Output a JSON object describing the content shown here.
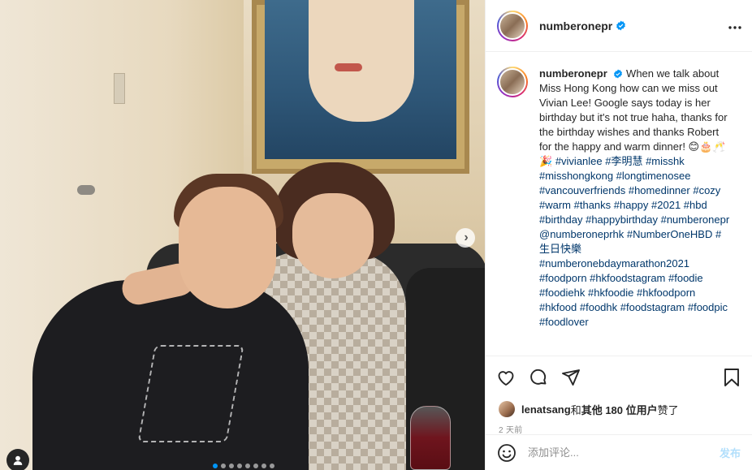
{
  "post": {
    "username": "numberonepr",
    "caption_text": "When we talk about Miss Hong Kong how can we miss out Vivian Lee! Google says today is her birthday but it's not true haha, thanks for the birthday wishes and thanks Robert for the happy and warm dinner! 😊🎂🥂🎉 ",
    "caption_tags": "#vivianlee #李明慧 #misshk #misshongkong #longtimenosee #vancouverfriends #homedinner #cozy #warm #thanks #happy #2021 #hbd #birthday #happybirthday #numberonepr @numberoneprhk #NumberOneHBD #生日快樂 #numberonebdaymarathon2021 #foodporn #hkfoodstagram #foodie #foodiehk #hkfoodie #hkfoodporn #hkfood #foodhk #foodstagram #foodpic #foodlover",
    "more_icon": "more-horizontal-icon",
    "verified_icon": "verified-badge-icon"
  },
  "media": {
    "next_icon": "chevron-right-icon",
    "next_glyph": "›",
    "tag_icon": "user-tag-icon",
    "slide_count": 8,
    "active_slide": 1
  },
  "actions": {
    "like_icon": "heart-icon",
    "comment_icon": "comment-icon",
    "share_icon": "send-icon",
    "save_icon": "bookmark-icon"
  },
  "likes": {
    "liker": "lenatsang",
    "connector": " 和 ",
    "others": "其他 180 位用户",
    "suffix": " 赞了"
  },
  "timestamp": "2 天前",
  "comment_box": {
    "emoji_icon": "emoji-icon",
    "placeholder": "添加评论...",
    "post_label": "发布"
  },
  "colors": {
    "link": "#00376b",
    "verified": "#0095f6",
    "post_button": "#b2dffc",
    "muted": "#8e8e8e"
  }
}
